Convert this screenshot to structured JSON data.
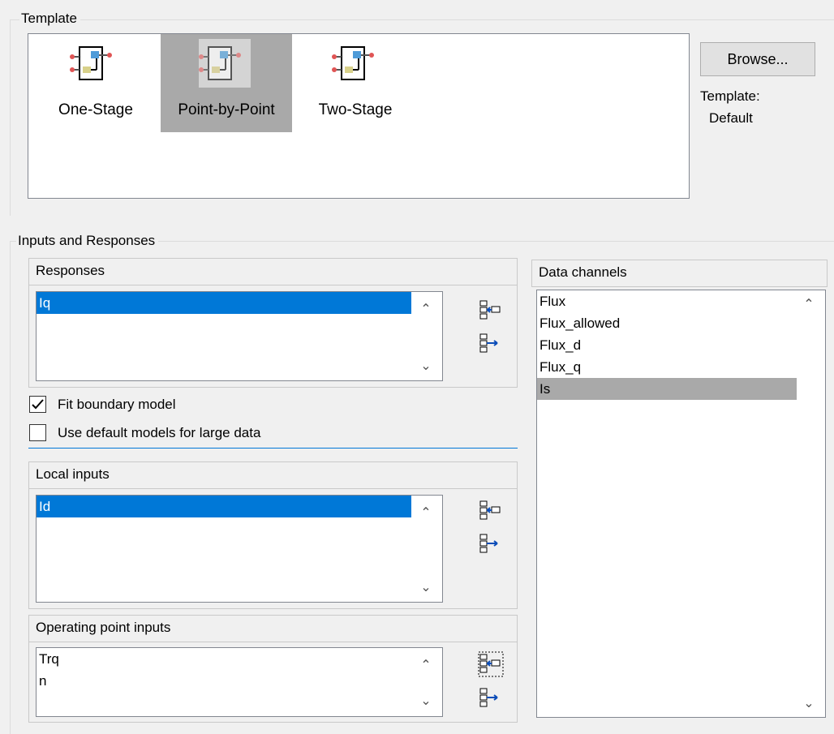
{
  "template_group": {
    "caption": "Template",
    "items": [
      {
        "label": "One-Stage",
        "icon": "model-block-icon",
        "selected": false
      },
      {
        "label": "Point-by-Point",
        "icon": "model-block-icon",
        "selected": true
      },
      {
        "label": "Two-Stage",
        "icon": "model-block-icon",
        "selected": false
      }
    ],
    "browse_label": "Browse...",
    "template_caption": "Template:",
    "template_value": "Default"
  },
  "io_group": {
    "caption": "Inputs and Responses",
    "responses": {
      "header": "Responses",
      "items": [
        "Iq"
      ],
      "selected_index": 0
    },
    "fit_boundary": {
      "label": "Fit boundary model",
      "checked": true
    },
    "default_models": {
      "label": "Use default models for large data",
      "checked": false
    },
    "local_inputs": {
      "header": "Local inputs",
      "items": [
        "Id"
      ],
      "selected_index": 0
    },
    "operating_inputs": {
      "header": "Operating point inputs",
      "items": [
        "Trq",
        "n"
      ]
    },
    "data_channels": {
      "header": "Data channels",
      "items": [
        "Flux",
        "Flux_allowed",
        "Flux_d",
        "Flux_q",
        "Is"
      ],
      "selected_index": 4
    }
  },
  "colors": {
    "selection_blue": "#0078d7",
    "selection_gray": "#a9a9a9",
    "window_bg": "#f0f0f0"
  }
}
